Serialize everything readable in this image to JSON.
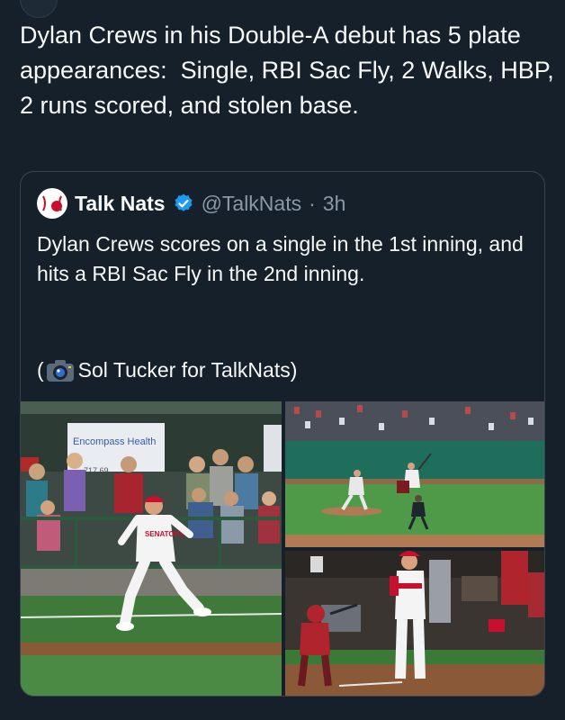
{
  "tweet": {
    "text": "Dylan Crews in his Double-A debut has 5 plate appearances:  Single, RBI Sac Fly, 2 Walks, HBP, 2 runs scored, and stolen base."
  },
  "quote": {
    "author_name": "Talk Nats",
    "verified_icon": "verified-badge-icon",
    "handle": "@TalkNats",
    "separator": "·",
    "time": "3h",
    "text": "Dylan Crews scores on a single in the 1st inning, and hits a RBI Sac Fly in the 2nd inning.",
    "credit_open": "(",
    "camera_icon": "camera-icon",
    "credit_text": "Sol Tucker for TalkNats)",
    "media": {
      "photo1": {
        "sign_text": "Encompass Health",
        "sign_number": "717.69"
      },
      "photo2": {},
      "photo3": {}
    }
  },
  "colors": {
    "background": "#15202b",
    "text": "#f7f9f9",
    "secondary_text": "#8b98a5",
    "border": "#38444d",
    "verified": "#1d9bf0"
  }
}
